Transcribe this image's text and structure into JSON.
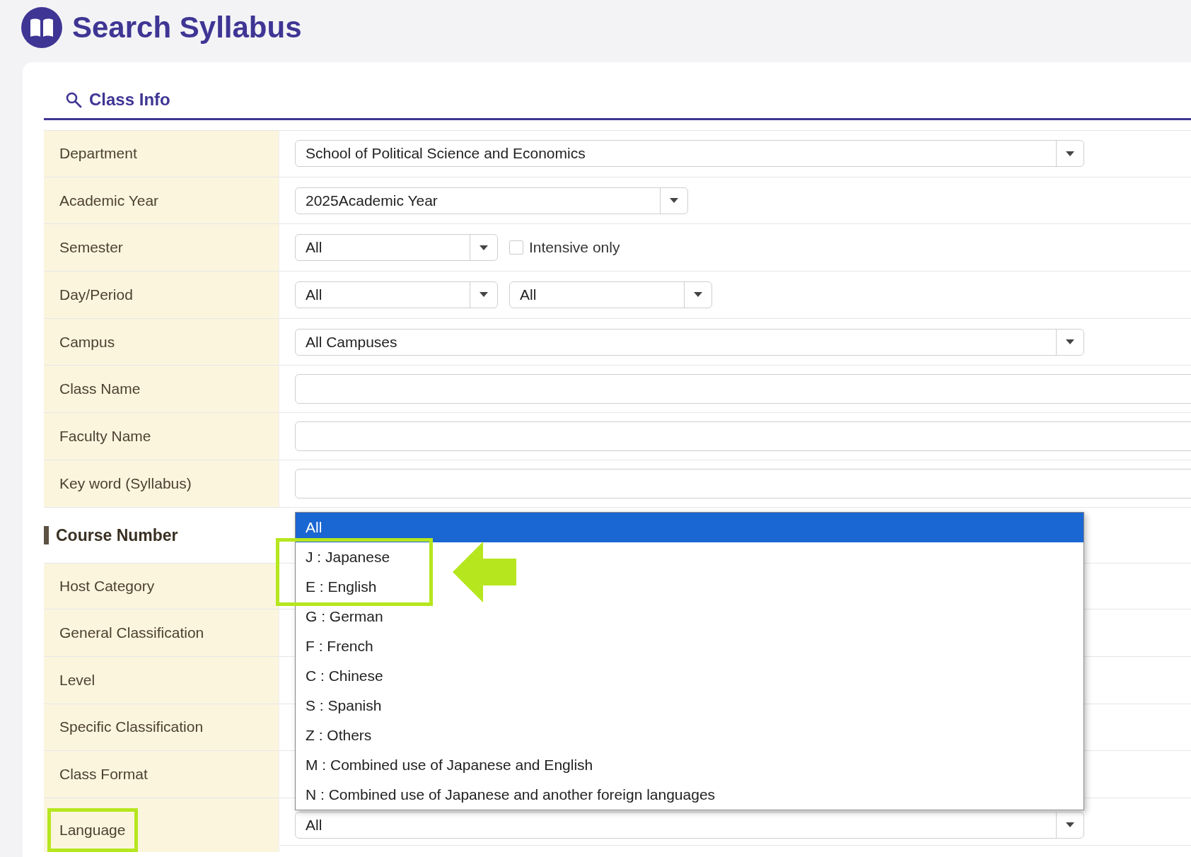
{
  "page": {
    "title": "Search Syllabus"
  },
  "class_info": {
    "heading": "Class Info",
    "rows": [
      {
        "label": "Department",
        "controls": [
          {
            "kind": "wide-select",
            "value": "School of Political Science and Economics"
          }
        ]
      },
      {
        "label": "Academic Year",
        "controls": [
          {
            "kind": "medium-select",
            "value": "2025Academic Year"
          }
        ]
      },
      {
        "label": "Semester",
        "controls": [
          {
            "kind": "small-select",
            "value": "All"
          },
          {
            "kind": "checkbox",
            "label": "Intensive only",
            "checked": false
          }
        ]
      },
      {
        "label": "Day/Period",
        "controls": [
          {
            "kind": "small-select",
            "value": "All"
          },
          {
            "kind": "small-select",
            "value": "All"
          }
        ]
      },
      {
        "label": "Campus",
        "controls": [
          {
            "kind": "wide-select",
            "value": "All Campuses"
          }
        ]
      },
      {
        "label": "Class Name",
        "controls": [
          {
            "kind": "text"
          }
        ]
      },
      {
        "label": "Faculty Name",
        "controls": [
          {
            "kind": "text"
          }
        ]
      },
      {
        "label": "Key word (Syllabus)",
        "controls": [
          {
            "kind": "text"
          }
        ]
      }
    ]
  },
  "course_number": {
    "heading": "Course Number",
    "rows": [
      {
        "label": "Host Category",
        "highlighted": false
      },
      {
        "label": "General Classification",
        "highlighted": false
      },
      {
        "label": "Level",
        "highlighted": false
      },
      {
        "label": "Specific Classification",
        "highlighted": false
      },
      {
        "label": "Class Format",
        "highlighted": false
      },
      {
        "label": "Language",
        "highlighted": true,
        "select": {
          "value": "All",
          "options": [
            {
              "label": "All",
              "selected": true,
              "highlighted": false
            },
            {
              "label": "J : Japanese",
              "selected": false,
              "highlighted": true
            },
            {
              "label": "E : English",
              "selected": false,
              "highlighted": true
            },
            {
              "label": "G : German",
              "selected": false,
              "highlighted": false
            },
            {
              "label": "F : French",
              "selected": false,
              "highlighted": false
            },
            {
              "label": "C : Chinese",
              "selected": false,
              "highlighted": false
            },
            {
              "label": "S : Spanish",
              "selected": false,
              "highlighted": false
            },
            {
              "label": "Z : Others",
              "selected": false,
              "highlighted": false
            },
            {
              "label": "M : Combined use of Japanese and English",
              "selected": false,
              "highlighted": false
            },
            {
              "label": "N : Combined use of Japanese and another foreign languages",
              "selected": false,
              "highlighted": false
            }
          ]
        }
      }
    ]
  }
}
